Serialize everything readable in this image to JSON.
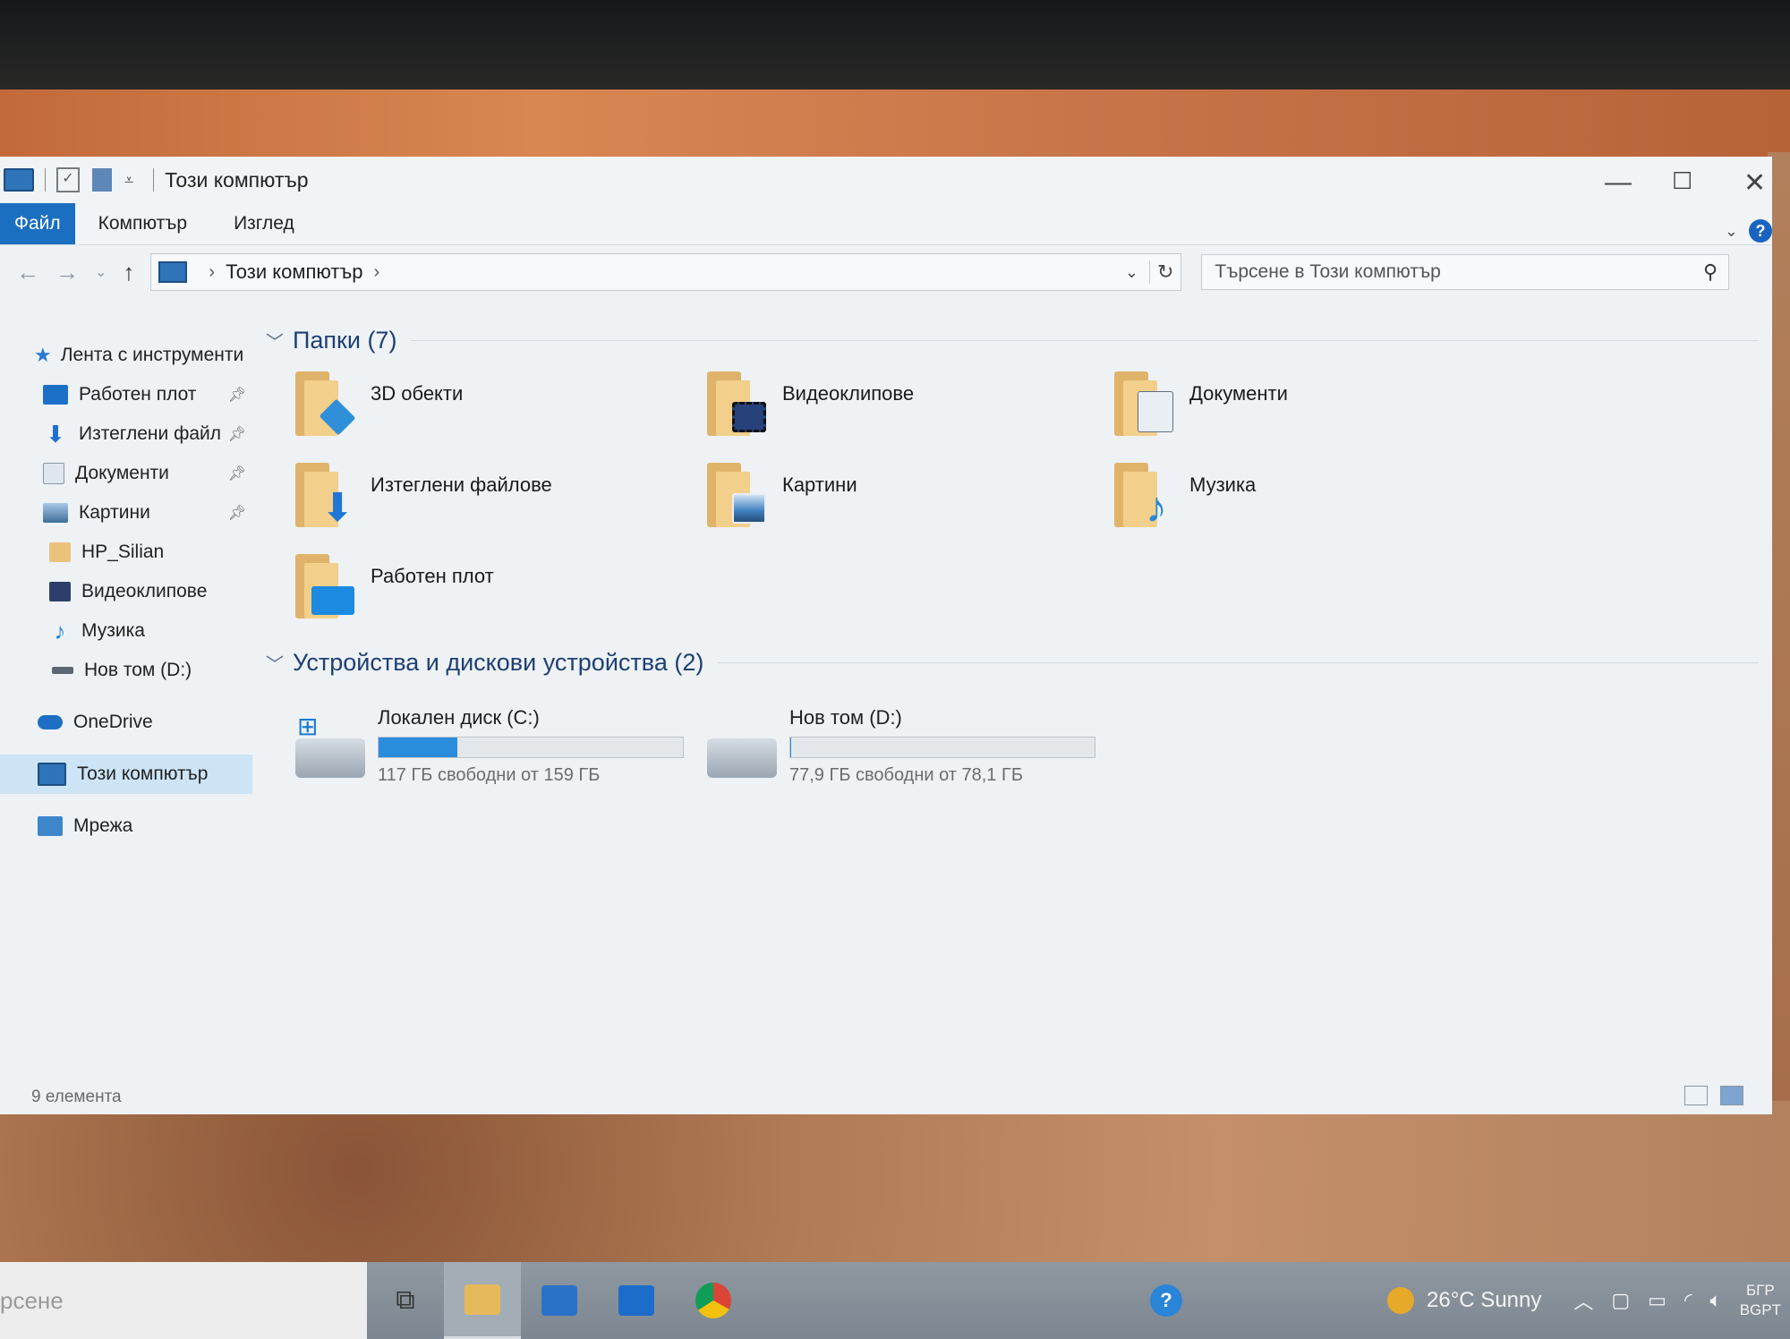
{
  "window": {
    "title": "Този компютър",
    "controls": {
      "minimize": "—",
      "maximize": "☐",
      "close": "✕"
    }
  },
  "ribbon": {
    "tabs": [
      "Файл",
      "Компютър",
      "Изглед"
    ],
    "help": "?"
  },
  "address": {
    "path": [
      "Този компютър"
    ],
    "separator": "›"
  },
  "search": {
    "placeholder": "Търсене в Този компютър"
  },
  "nav": {
    "quick_access": "Лента с инструменти",
    "items": [
      {
        "label": "Работен плот",
        "pinned": true,
        "icon": "desktop-icon"
      },
      {
        "label": "Изтеглени файл",
        "pinned": true,
        "icon": "download-icon"
      },
      {
        "label": "Документи",
        "pinned": true,
        "icon": "documents-icon"
      },
      {
        "label": "Картини",
        "pinned": true,
        "icon": "pictures-icon"
      },
      {
        "label": "HP_Silian",
        "pinned": false,
        "icon": "folder-icon"
      },
      {
        "label": "Видеоклипове",
        "pinned": false,
        "icon": "videos-icon"
      },
      {
        "label": "Музика",
        "pinned": false,
        "icon": "music-icon"
      },
      {
        "label": "Нов том (D:)",
        "pinned": false,
        "icon": "drive-icon"
      }
    ],
    "onedrive": "OneDrive",
    "this_pc": "Този компютър",
    "network": "Мрежа"
  },
  "content": {
    "folders_header": "Папки (7)",
    "folders": [
      {
        "label": "3D обекти",
        "icon": "3d-objects-icon",
        "color": "#2f8fd8"
      },
      {
        "label": "Видеоклипове",
        "icon": "videos-icon",
        "color": "#27417a"
      },
      {
        "label": "Документи",
        "icon": "documents-icon",
        "color": "#e9eef4"
      },
      {
        "label": "Изтеглени файлове",
        "icon": "download-icon",
        "color": "#1f77d4"
      },
      {
        "label": "Картини",
        "icon": "pictures-icon",
        "color": "#3e7fbf"
      },
      {
        "label": "Музика",
        "icon": "music-icon",
        "color": "#2a86d6"
      },
      {
        "label": "Работен плот",
        "icon": "desktop-icon",
        "color": "#1b8ae0"
      }
    ],
    "drives_header": "Устройства и дискови устройства (2)",
    "drives": [
      {
        "name": "Локален диск (C:)",
        "free": "117 ГБ свободни от 159 ГБ",
        "used_fraction": 0.26,
        "system": true
      },
      {
        "name": "Нов том (D:)",
        "free": "77,9 ГБ свободни от 78,1 ГБ",
        "used_fraction": 0.003,
        "system": false
      }
    ]
  },
  "status": {
    "count": "9 елемента"
  },
  "taskbar": {
    "search_text": "рсене",
    "weather": "26°C  Sunny",
    "lang_top": "БГР",
    "lang_bottom": "BGPT"
  },
  "colors": {
    "accent": "#1a6fc0",
    "selection": "#cce4f5",
    "bar_fill": "#2a8cdc"
  }
}
